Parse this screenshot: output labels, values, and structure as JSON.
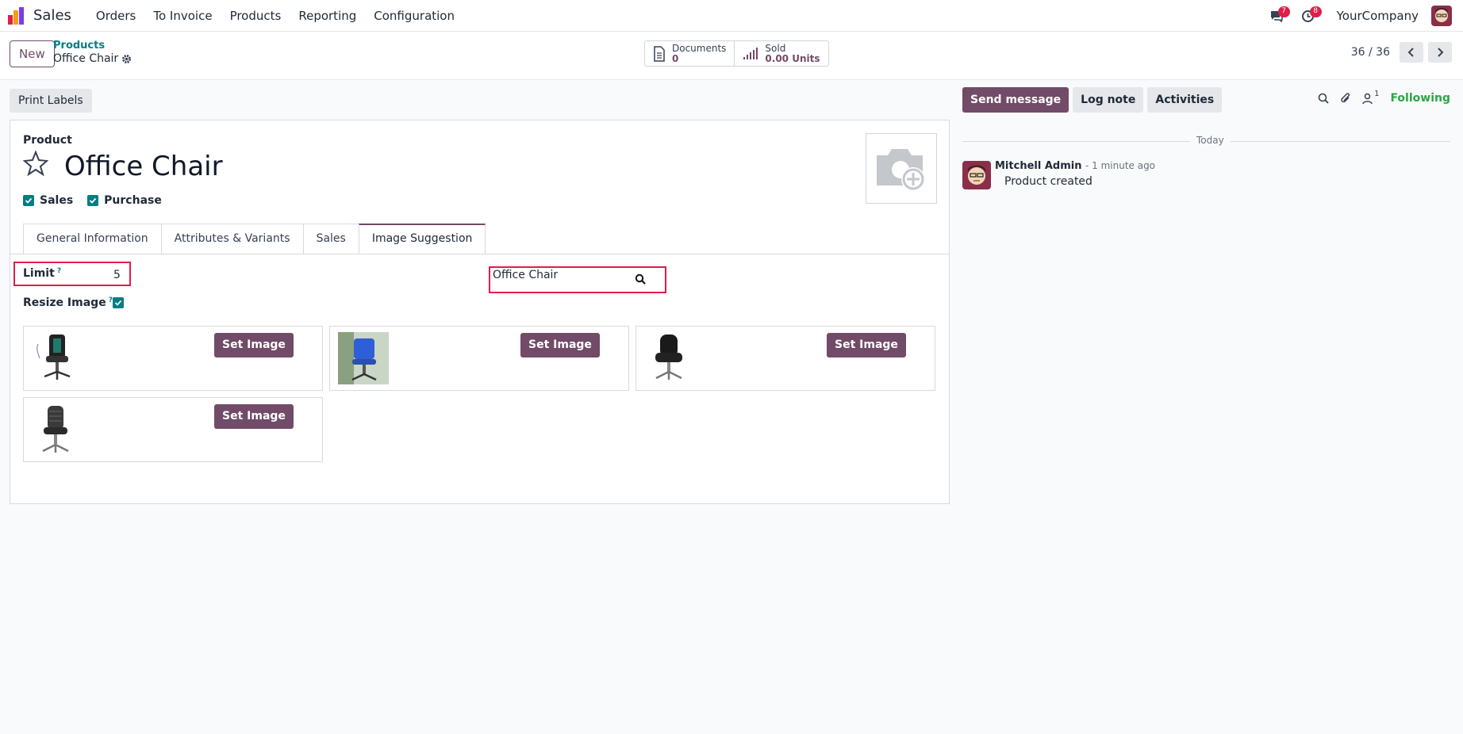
{
  "navbar": {
    "app_name": "Sales",
    "menu": [
      "Orders",
      "To Invoice",
      "Products",
      "Reporting",
      "Configuration"
    ],
    "messages_count": "7",
    "activities_count": "8",
    "company": "YourCompany"
  },
  "control": {
    "new_label": "New",
    "breadcrumb_parent": "Products",
    "breadcrumb_current": "Office Chair",
    "documents_label": "Documents",
    "documents_value": "0",
    "sold_label": "Sold",
    "sold_value": "0.00 Units",
    "pager": "36 / 36"
  },
  "buttons": {
    "print_labels": "Print Labels"
  },
  "form": {
    "product_label": "Product",
    "title": "Office Chair",
    "checks": [
      {
        "label": "Sales",
        "checked": true
      },
      {
        "label": "Purchase",
        "checked": true
      }
    ],
    "tabs": [
      "General Information",
      "Attributes & Variants",
      "Sales",
      "Image Suggestion"
    ],
    "active_tab": "Image Suggestion",
    "limit_label": "Limit",
    "limit_help": "?",
    "limit_value": "5",
    "resize_label": "Resize Image",
    "resize_help": "?",
    "search_value": "Office Chair",
    "set_image_label": "Set Image",
    "suggestions": [
      {
        "icon": "black-massage-chair"
      },
      {
        "icon": "blue-mesh-chair"
      },
      {
        "icon": "black-leather-chair"
      },
      {
        "icon": "grey-leather-chair"
      }
    ]
  },
  "chatter": {
    "send_message": "Send message",
    "log_note": "Log note",
    "activities": "Activities",
    "followers_count": "1",
    "following": "Following",
    "today": "Today",
    "author": "Mitchell Admin",
    "time": "- 1 minute ago",
    "body": "Product created"
  },
  "colors": {
    "primary": "#714b67",
    "teal": "#017e84",
    "highlight": "#e11d48",
    "following": "#28a745"
  }
}
